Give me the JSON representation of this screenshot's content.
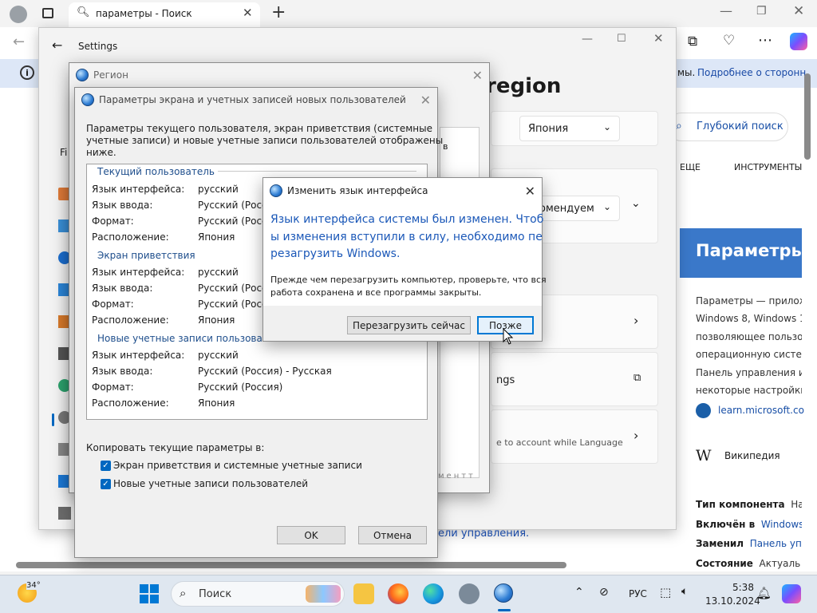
{
  "browser": {
    "tab_title": "параметры - Поиск",
    "info_text": "мы.",
    "info_link": "Подробнее о сторонн",
    "deep_search": "Глубокий поиск",
    "tab_more": "ЕЩЕ",
    "tab_tools": "ИНСТРУМЕНТЫ",
    "kp_title": "Параметры",
    "kp_desc": [
      "Параметры — прилож",
      "Windows 8, Windows 1",
      "позволяющее пользо",
      "операционную систе",
      "Панель управления и",
      "некоторые настройки,"
    ],
    "kp_link": "learn.microsoft.co",
    "kp_wiki": "Википедия",
    "kp_facts": [
      {
        "k": "Тип компонента",
        "v": "На"
      },
      {
        "k": "Включён в",
        "v": "Windows"
      },
      {
        "k": "Заменил",
        "v": "Панель упр"
      },
      {
        "k": "Состояние",
        "v": "Актуаль"
      }
    ],
    "bottom_link": "ели управления."
  },
  "settings": {
    "title": "Settings",
    "heading": "region",
    "country_value": "Япония",
    "rec_value": "омендуем",
    "ngs_text": "ngs",
    "account_text": "e to account while Language",
    "search_letter": "Fi",
    "faded_label": "ментт"
  },
  "region": {
    "title": "Регион"
  },
  "welcome": {
    "title": "Параметры экрана и учетных записей новых пользователей",
    "intro": [
      "Параметры текущего пользователя, экран приветствия (системные",
      "учетные записи) и новые учетные записи пользователей отображены",
      "ниже."
    ],
    "sections": [
      {
        "name": "Текущий пользователь",
        "rows": [
          {
            "k": "Язык интерфейса:",
            "v": "русский"
          },
          {
            "k": "Язык ввода:",
            "v": "Русский (Росс"
          },
          {
            "k": "Формат:",
            "v": "Русский (Росс"
          },
          {
            "k": "Расположение:",
            "v": "Япония"
          }
        ]
      },
      {
        "name": "Экран приветствия",
        "rows": [
          {
            "k": "Язык интерфейса:",
            "v": "русский"
          },
          {
            "k": "Язык ввода:",
            "v": "Русский (Росс"
          },
          {
            "k": "Формат:",
            "v": "Русский (Росс"
          },
          {
            "k": "Расположение:",
            "v": "Япония"
          }
        ]
      },
      {
        "name": "Новые учетные записи пользователей",
        "rows": [
          {
            "k": "Язык интерфейса:",
            "v": "русский"
          },
          {
            "k": "Язык ввода:",
            "v": "Русский (Россия) - Русская"
          },
          {
            "k": "Формат:",
            "v": "Русский (Россия)"
          },
          {
            "k": "Расположение:",
            "v": "Япония"
          }
        ]
      }
    ],
    "copy_label": "Копировать текущие параметры в:",
    "cb1": "Экран приветствия и системные учетные записи",
    "cb2": "Новые учетные записи пользователей",
    "ok": "OK",
    "cancel": "Отмена",
    "partial_b": "в"
  },
  "change_lang": {
    "title": "Изменить язык интерфейса",
    "main": [
      "Язык интерфейса системы был изменен. Чтоб",
      "ы изменения вступили в силу, необходимо пе",
      "резагрузить Windows."
    ],
    "sub": [
      "Прежде чем перезагрузить компьютер, проверьте, что вся",
      "работа сохранена и все программы закрыты."
    ],
    "restart": "Перезагрузить сейчас",
    "later": "Позже"
  },
  "taskbar": {
    "temp": "34°",
    "search": "Поиск",
    "lang": "РУС",
    "time": "5:38",
    "date": "13.10.2024"
  }
}
